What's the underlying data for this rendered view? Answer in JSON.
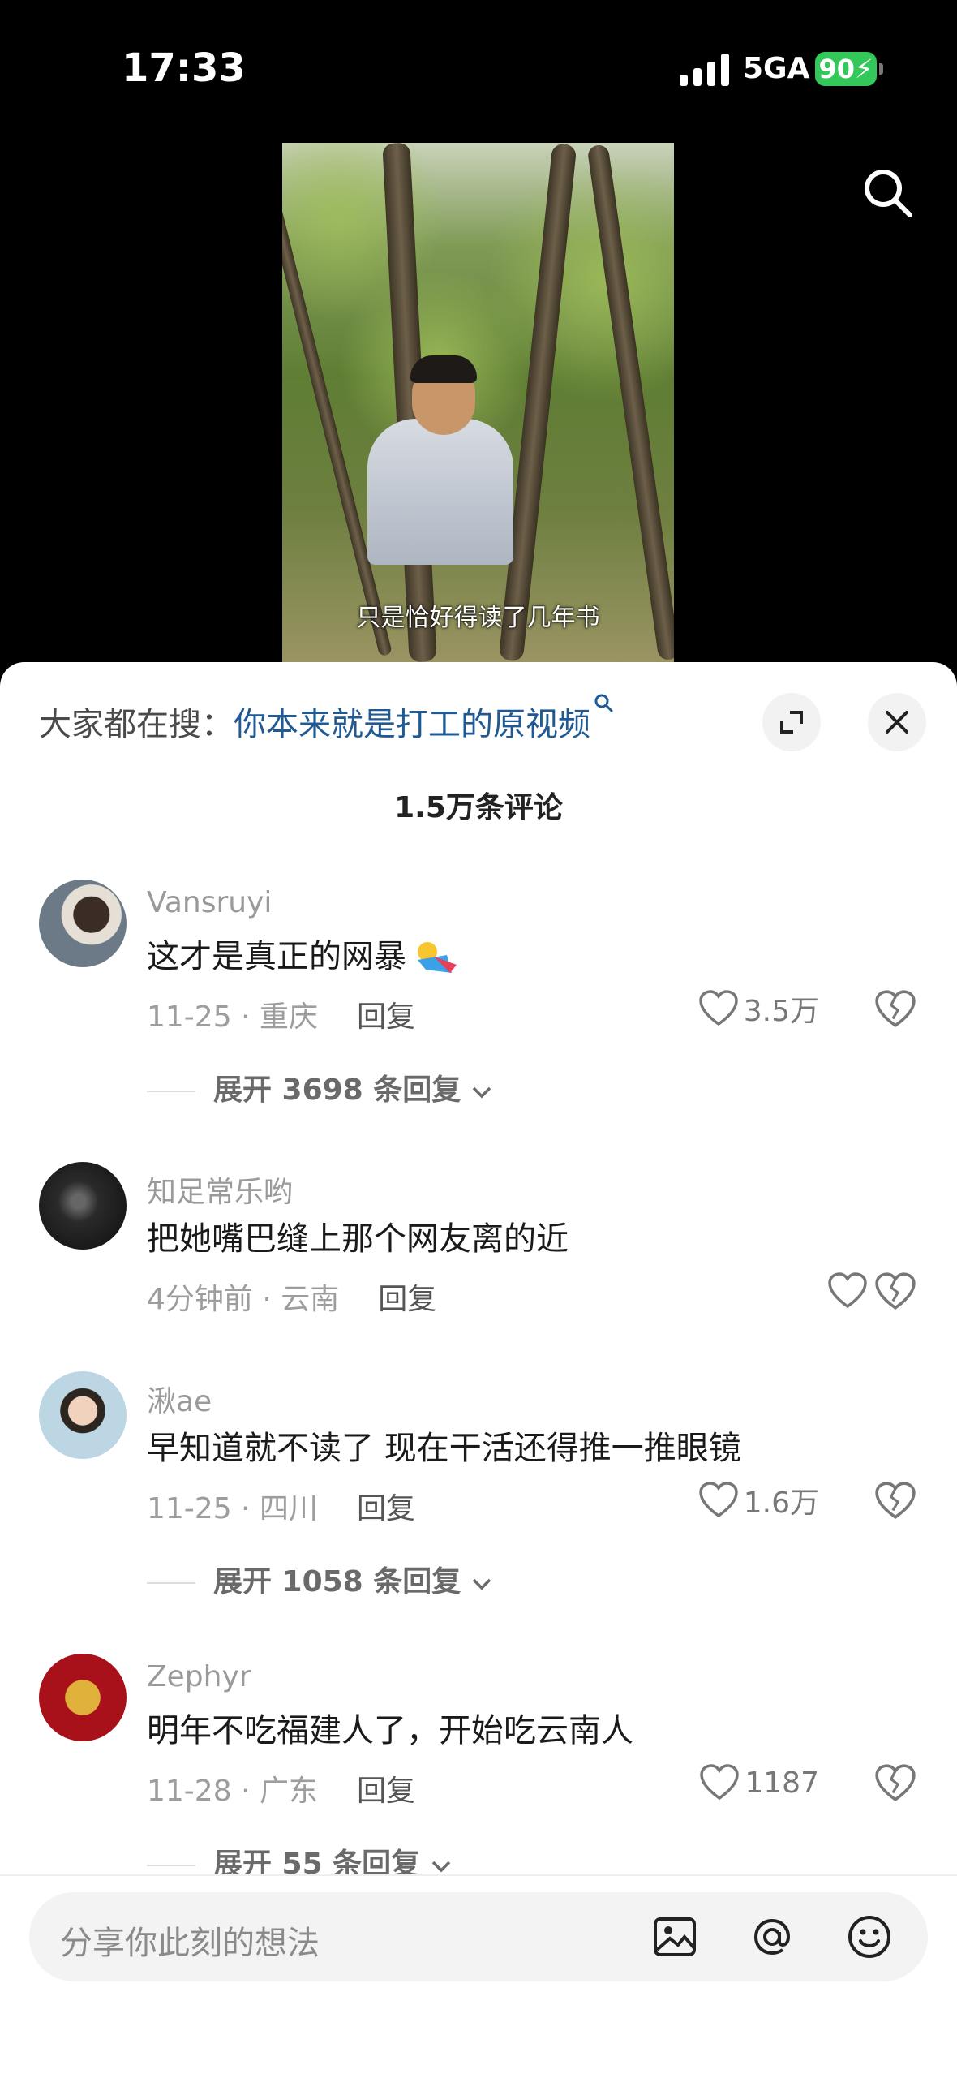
{
  "status_bar": {
    "time": "17:33",
    "network": "5GA",
    "battery": "90"
  },
  "video": {
    "caption": "只是恰好得读了几年书"
  },
  "icons": {
    "search": "search-icon",
    "expand": "expand-icon",
    "close": "close-icon",
    "like": "heart-icon",
    "dislike": "broken-heart-icon",
    "image": "image-icon",
    "at": "at-icon",
    "emoji": "smiley-icon"
  },
  "sheet": {
    "suggest_label": "大家都在搜：",
    "suggest_query": "你本来就是打工的原视频",
    "comments_count": "1.5万条评论"
  },
  "comments": [
    {
      "user": "Vansruyi",
      "text": "这才是真正的网暴",
      "date": "11-25",
      "location": "重庆",
      "reply_label": "回复",
      "likes": "3.5万",
      "expand": "展开 3698 条回复"
    },
    {
      "user": "知足常乐哟",
      "text": "把她嘴巴缝上那个网友离的近",
      "date": "4分钟前",
      "location": "云南",
      "reply_label": "回复",
      "likes": "",
      "expand": ""
    },
    {
      "user": "湫ae",
      "text": "早知道就不读了   现在干活还得推一推眼镜",
      "date": "11-25",
      "location": "四川",
      "reply_label": "回复",
      "likes": "1.6万",
      "expand": "展开 1058 条回复"
    },
    {
      "user": "Zephyr",
      "text": "明年不吃福建人了，开始吃云南人",
      "date": "11-28",
      "location": "广东",
      "reply_label": "回复",
      "likes": "1187",
      "expand": "展开 55 条回复"
    }
  ],
  "input": {
    "placeholder": "分享你此刻的想法"
  },
  "colors": {
    "accent_link": "#1f5a95",
    "battery": "#34c759",
    "background_top": "#000000"
  }
}
